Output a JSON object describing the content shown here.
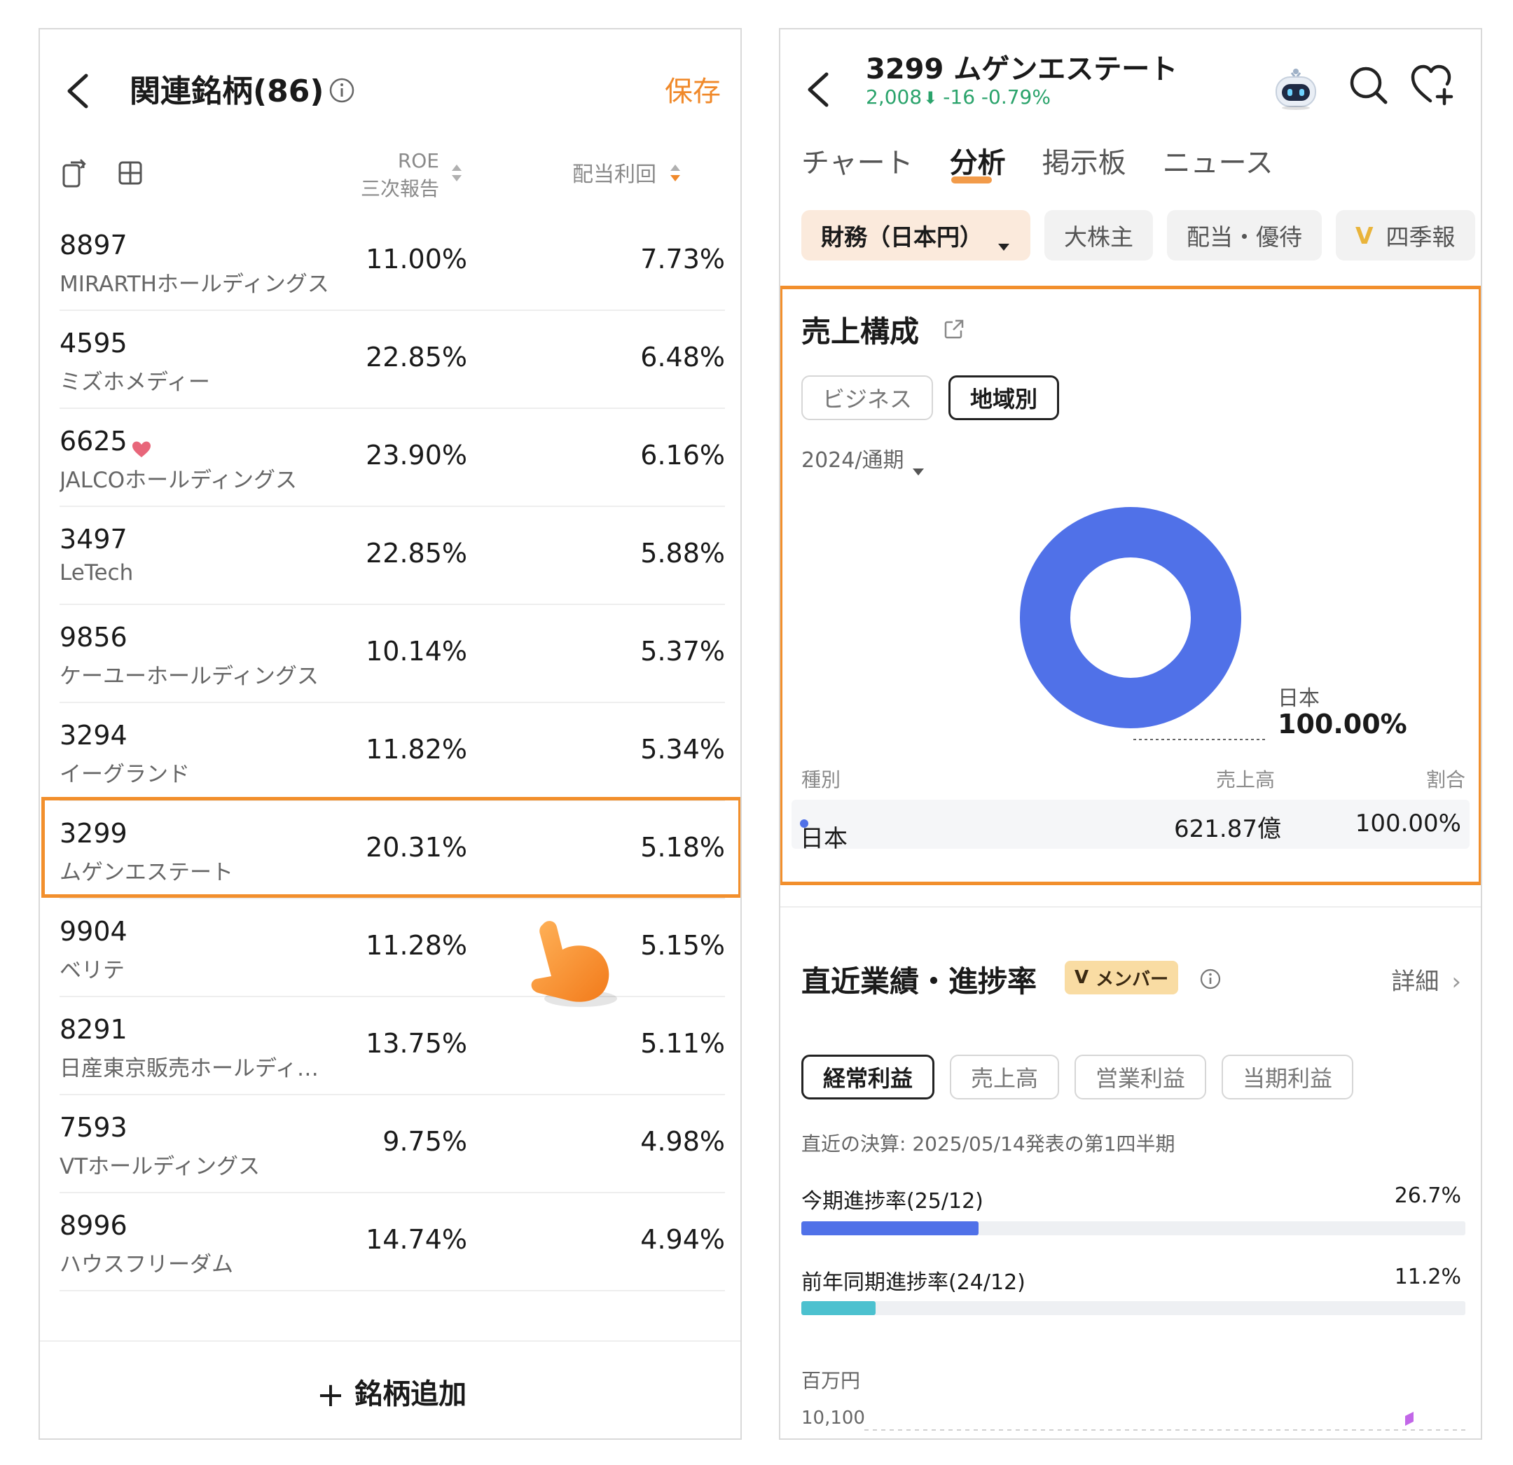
{
  "left": {
    "title": "関連銘柄(86)",
    "save_label": "保存",
    "col_roe_line1": "ROE",
    "col_roe_line2": "三次報告",
    "col_dividend": "配当利回",
    "stocks": [
      {
        "code": "8897",
        "name": "MIRARTHホールディングス",
        "roe": "11.00%",
        "div": "7.73%"
      },
      {
        "code": "4595",
        "name": "ミズホメディー",
        "roe": "22.85%",
        "div": "6.48%"
      },
      {
        "code": "6625",
        "name": "JALCOホールディングス",
        "roe": "23.90%",
        "div": "6.16%"
      },
      {
        "code": "3497",
        "name": "LeTech",
        "roe": "22.85%",
        "div": "5.88%"
      },
      {
        "code": "9856",
        "name": "ケーユーホールディングス",
        "roe": "10.14%",
        "div": "5.37%"
      },
      {
        "code": "3294",
        "name": "イーグランド",
        "roe": "11.82%",
        "div": "5.34%"
      },
      {
        "code": "3299",
        "name": "ムゲンエステート",
        "roe": "20.31%",
        "div": "5.18%"
      },
      {
        "code": "9904",
        "name": "ベリテ",
        "roe": "11.28%",
        "div": "5.15%"
      },
      {
        "code": "8291",
        "name": "日産東京販売ホールディン…",
        "roe": "13.75%",
        "div": "5.11%"
      },
      {
        "code": "7593",
        "name": "VTホールディングス",
        "roe": "9.75%",
        "div": "4.98%"
      },
      {
        "code": "8996",
        "name": "ハウスフリーダム",
        "roe": "14.74%",
        "div": "4.94%"
      }
    ],
    "add_label": "銘柄追加",
    "accent_color": "#f0892a"
  },
  "right": {
    "title": "3299  ムゲンエステート",
    "price": "2,008",
    "change": "-16  -0.79%",
    "price_color": "#2aa36b",
    "tabs": [
      "チャート",
      "分析",
      "掲示板",
      "ニュース"
    ],
    "active_tab": "分析",
    "chips": [
      "財務（日本円）",
      "大株主",
      "配当・優待",
      "四季報"
    ],
    "chip_vip_mark": "V",
    "sales": {
      "title": "売上構成",
      "segments": [
        "ビジネス",
        "地域別"
      ],
      "active_segment": "地域別",
      "period": "2024/通期",
      "donut_label": "日本",
      "donut_value": "100.00%",
      "table_headers": [
        "種別",
        "売上高",
        "割合"
      ],
      "rows": [
        {
          "type": "日本",
          "sales": "621.87億",
          "ratio": "100.00%"
        }
      ],
      "donut_color": "#5071e8"
    },
    "performance": {
      "title": "直近業績・進捗率",
      "member_badge_mark": "V",
      "member_badge": "メンバー",
      "detail_label": "詳細",
      "tabs": [
        "経常利益",
        "売上高",
        "営業利益",
        "当期利益"
      ],
      "active_tab": "経常利益",
      "latest": "直近の決算: 2025/05/14発表の第1四半期",
      "progress": [
        {
          "label": "今期進捗率(25/12)",
          "value": "26.7%",
          "fraction": 0.267,
          "color": "#5071e8"
        },
        {
          "label": "前年同期進捗率(24/12)",
          "value": "11.2%",
          "fraction": 0.112,
          "color": "#4cc1cf"
        }
      ],
      "unit": "百万円",
      "axis_top": "10,100"
    }
  }
}
